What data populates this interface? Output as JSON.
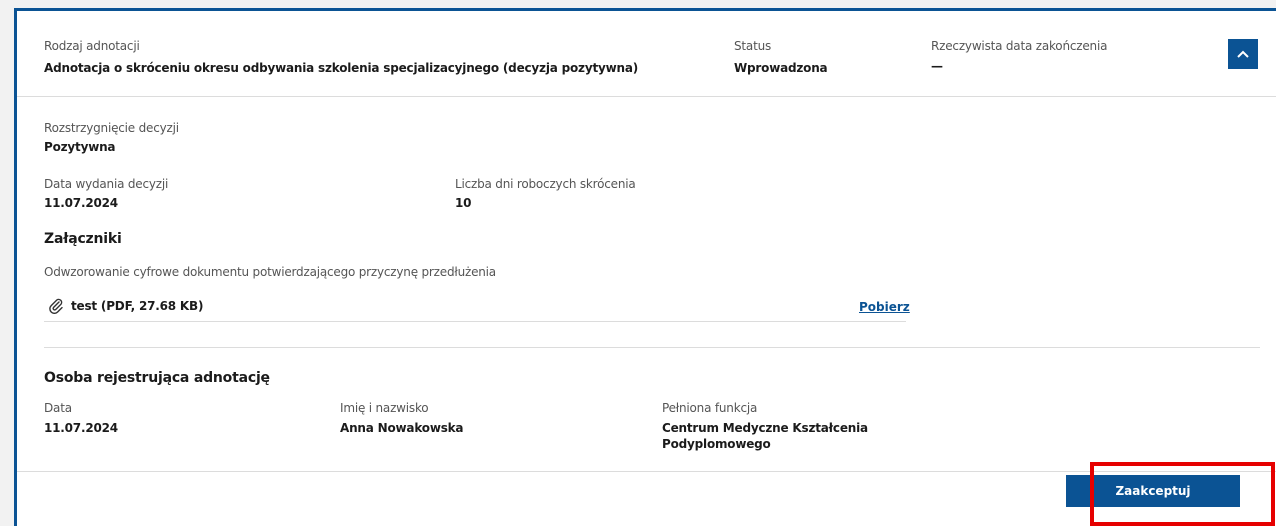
{
  "header": {
    "type_label": "Rodzaj adnotacji",
    "type_value": "Adnotacja o skróceniu okresu odbywania szkolenia specjalizacyjnego (decyzja pozytywna)",
    "status_label": "Status",
    "status_value": "Wprowadzona",
    "end_date_label": "Rzeczywista data zakończenia",
    "end_date_value": "—",
    "toggle_icon": "chevron-up-icon"
  },
  "decision": {
    "resolution_label": "Rozstrzygnięcie decyzji",
    "resolution_value": "Pozytywna",
    "issue_date_label": "Data wydania decyzji",
    "issue_date_value": "11.07.2024",
    "days_label": "Liczba dni roboczych skrócenia",
    "days_value": "10"
  },
  "attachments": {
    "title": "Załączniki",
    "description": "Odwzorowanie cyfrowe dokumentu potwierdzającego przyczynę przedłużenia",
    "file_label": "test (PDF, 27.68 KB)",
    "file_icon": "paperclip-icon",
    "download_label": "Pobierz"
  },
  "registrar": {
    "title": "Osoba rejestrująca adnotację",
    "date_label": "Data",
    "date_value": "11.07.2024",
    "name_label": "Imię i nazwisko",
    "name_value": "Anna Nowakowska",
    "function_label": "Pełniona funkcja",
    "function_value_line1": "Centrum Medyczne Kształcenia",
    "function_value_line2": "Podyplomowego"
  },
  "actions": {
    "accept_label": "Zaakceptuj"
  },
  "colors": {
    "accent": "#0b5394",
    "highlight": "#e60000"
  }
}
